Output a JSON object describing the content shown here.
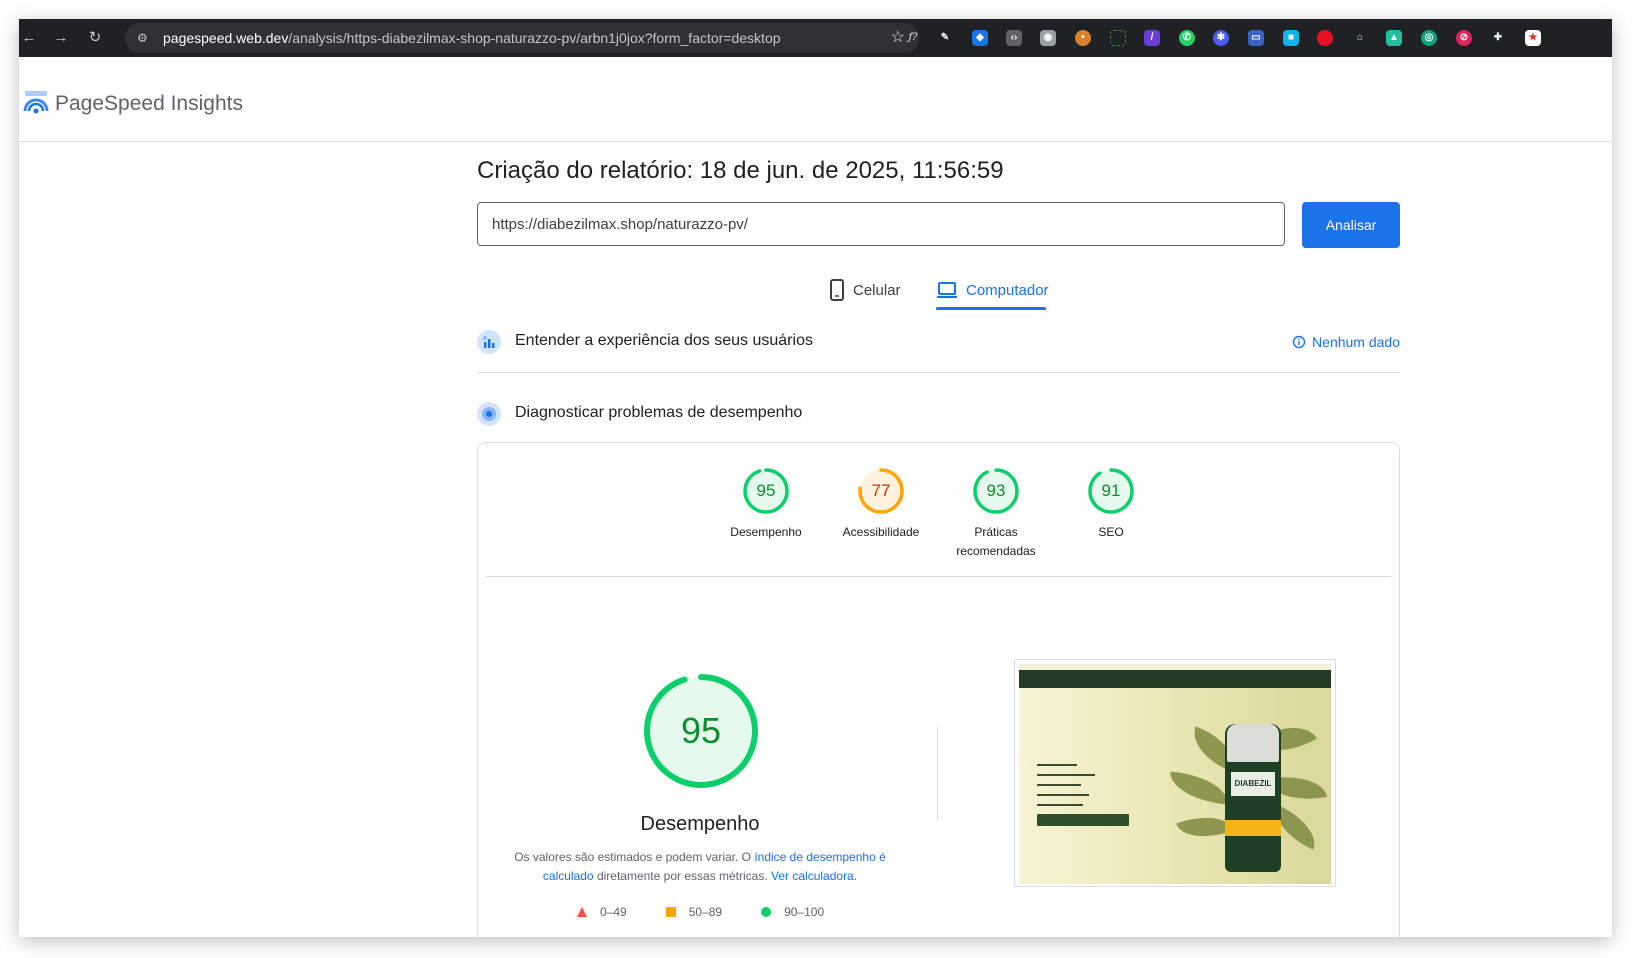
{
  "browser": {
    "url_host": "pagespeed.web.dev",
    "url_path": "/analysis/https-diabezilmax-shop-naturazzo-pv/arbn1j0jox?form_factor=desktop"
  },
  "app": {
    "title": "PageSpeed Insights"
  },
  "report": {
    "title": "Criação do relatório: 18 de jun. de 2025, 11:56:59",
    "url_value": "https://diabezilmax.shop/naturazzo-pv/",
    "analyze_label": "Analisar"
  },
  "tabs": [
    {
      "label": "Celular",
      "active": false
    },
    {
      "label": "Computador",
      "active": true
    }
  ],
  "sections": {
    "field": {
      "label": "Entender a experiência dos seus usuários",
      "status": "Nenhum dado"
    },
    "lab": {
      "label": "Diagnosticar problemas de desempenho"
    }
  },
  "scores": [
    {
      "value": "95",
      "label": "Desempenho",
      "color": "#0cce6b",
      "text_color": "#0c8d32"
    },
    {
      "value": "77",
      "label": "Acessibilidade",
      "color": "#ffa400",
      "text_color": "#c33300"
    },
    {
      "value": "93",
      "label": "Práticas recomendadas",
      "color": "#0cce6b",
      "text_color": "#0c8d32"
    },
    {
      "value": "91",
      "label": "SEO",
      "color": "#0cce6b",
      "text_color": "#0c8d32"
    }
  ],
  "performance": {
    "score": "95",
    "label": "Desempenho",
    "note_text_1": "Os valores são estimados e podem variar. O ",
    "note_link_1": "índice de desempenho é calculado",
    "note_text_2": " diretamente por essas métricas. ",
    "note_link_2": "Ver calculadora."
  },
  "legend": [
    {
      "range": "0–49",
      "color": "#ff4e42",
      "shape": "triangle"
    },
    {
      "range": "50–89",
      "color": "#ffa400",
      "shape": "square"
    },
    {
      "range": "90–100",
      "color": "#0cce6b",
      "shape": "circle"
    }
  ],
  "preview": {
    "product_label": "DIABEZIL"
  },
  "colors": {
    "accent": "#1a73e8",
    "pass": "#0cce6b",
    "average": "#ffa400",
    "fail": "#ff4e42"
  }
}
